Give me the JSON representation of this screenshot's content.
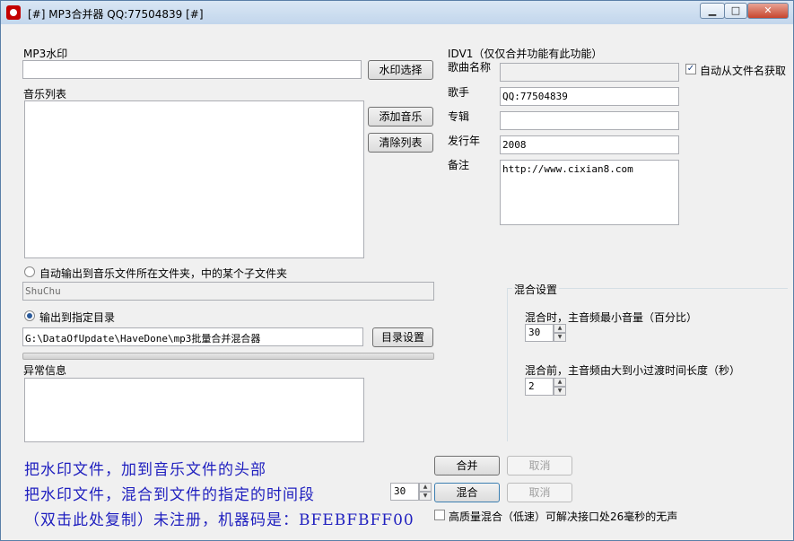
{
  "window": {
    "title": "[#] MP3合并器 QQ:77504839 [#]"
  },
  "titlebar_buttons": {
    "minimize": "▁",
    "maximize": "□",
    "close": "✕"
  },
  "watermark": {
    "label": "MP3水印",
    "value": "",
    "select_button": "水印选择"
  },
  "music_list": {
    "label": "音乐列表",
    "add_button": "添加音乐",
    "clear_button": "清除列表"
  },
  "id3": {
    "header": "IDV1（仅仅合并功能有此功能）",
    "song_name_label": "歌曲名称",
    "song_name_value": "",
    "auto_label": "自动从文件名获取",
    "auto_checked": true,
    "artist_label": "歌手",
    "artist_value": "QQ:77504839",
    "album_label": "专辑",
    "album_value": "",
    "year_label": "发行年",
    "year_value": "2008",
    "note_label": "备注",
    "note_value": "http://www.cixian8.com"
  },
  "output": {
    "auto_radio_label": "自动输出到音乐文件所在文件夹，中的某个子文件夹",
    "subfolder_value": "ShuChu",
    "dir_radio_label": "输出到指定目录",
    "dir_value": "G:\\DataOfUpdate\\HaveDone\\mp3批量合并混合器",
    "dir_button": "目录设置",
    "selected": "dir",
    "progress": 0
  },
  "errors": {
    "label": "异常信息",
    "value": ""
  },
  "mix": {
    "group_label": "混合设置",
    "min_volume_label": "混合时，主音频最小音量（百分比）",
    "min_volume_value": "30",
    "fade_label": "混合前，主音频由大到小过渡时间长度（秒）",
    "fade_value": "2"
  },
  "bottom": {
    "line1": "把水印文件，加到音乐文件的头部",
    "line2": "把水印文件，混合到文件的指定的时间段",
    "line3": "（双击此处复制）未注册，机器码是：BFEBFBFF00",
    "offset_value": "30",
    "merge_button": "合并",
    "mix_button": "混合",
    "cancel1": "取消",
    "cancel2": "取消",
    "hq_label": "高质量混合（低速）可解决接口处26毫秒的无声",
    "hq_checked": false
  }
}
